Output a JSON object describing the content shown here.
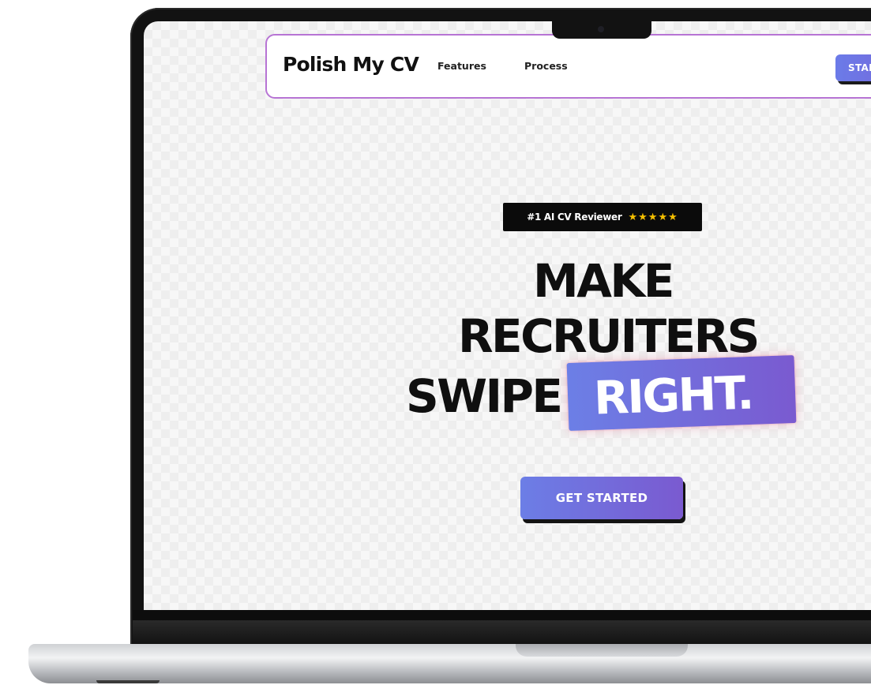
{
  "site": {
    "logo": "Polish My CV",
    "nav": {
      "features_label": "Features",
      "process_label": "Process",
      "cta_label": "STAR"
    },
    "badge": {
      "text": "#1 AI CV Reviewer",
      "stars": "★★★★★"
    },
    "hero": {
      "line1": "MAKE",
      "line2": "RECRUITERS",
      "line3": "SWIPE",
      "highlight": "RIGHT.",
      "cta_label": "GET STARTED"
    }
  },
  "colors": {
    "accent_gradient_start": "#6c7ee6",
    "accent_gradient_end": "#7a5ad0",
    "nav_border": "#b774d4",
    "star": "#f6c000",
    "text_dark": "#0f0f0f"
  },
  "icons": {
    "camera": "camera-icon",
    "rating": "star-icon"
  }
}
